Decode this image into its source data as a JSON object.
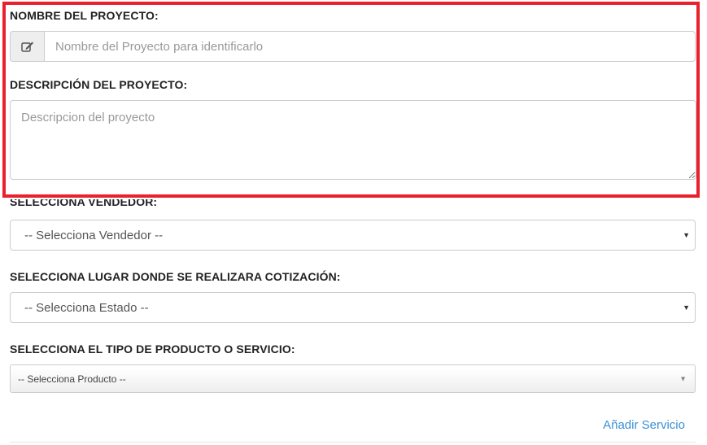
{
  "project_name": {
    "label": "NOMBRE DEL PROYECTO:",
    "placeholder": "Nombre del Proyecto para identificarlo",
    "value": ""
  },
  "project_description": {
    "label": "DESCRIPCIÓN DEL PROYECTO:",
    "placeholder": "Descripcion del proyecto",
    "value": ""
  },
  "seller": {
    "label": "SELECCIONA VENDEDOR:",
    "selected": "-- Selecciona Vendedor --"
  },
  "location": {
    "label": "SELECCIONA LUGAR DONDE SE REALIZARA COTIZACIÓN:",
    "selected": "-- Selecciona Estado --"
  },
  "product_type": {
    "label": "SELECCIONA EL TIPO DE PRODUCTO O SERVICIO:",
    "selected": "-- Selecciona Producto --"
  },
  "add_service_link": "Añadir Servicio",
  "icons": {
    "project_name_addon": "edit-icon",
    "select_caret": "caret-down-icon"
  },
  "colors": {
    "highlight_border": "#e8212c",
    "link": "#3b8fd5"
  }
}
